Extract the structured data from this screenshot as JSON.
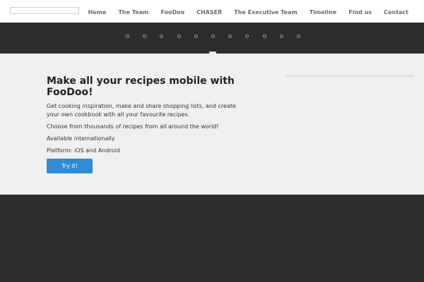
{
  "header": {
    "nav": [
      "Home",
      "The Team",
      "FooDoo",
      "CHASER",
      "The Executive Team",
      "Timeline",
      "Find us",
      "Contact"
    ]
  },
  "slider": {
    "dot_count": 11
  },
  "main": {
    "title": "Make all your recipes mobile with FooDoo!",
    "paragraphs": [
      "Get cooking inspiration, make and share shopping lists, and create your own cookbook with all your favourite recipes.",
      "Choose from thousands of recipes from all around the world!",
      "Available internationally",
      "Platform: iOS and Android"
    ],
    "button_label": "Try it!"
  },
  "colors": {
    "accent": "#2f8bd6",
    "dark_band": "#2d2d2d",
    "content_bg": "#f0f0f0",
    "nav_text": "#6a6a6a"
  }
}
